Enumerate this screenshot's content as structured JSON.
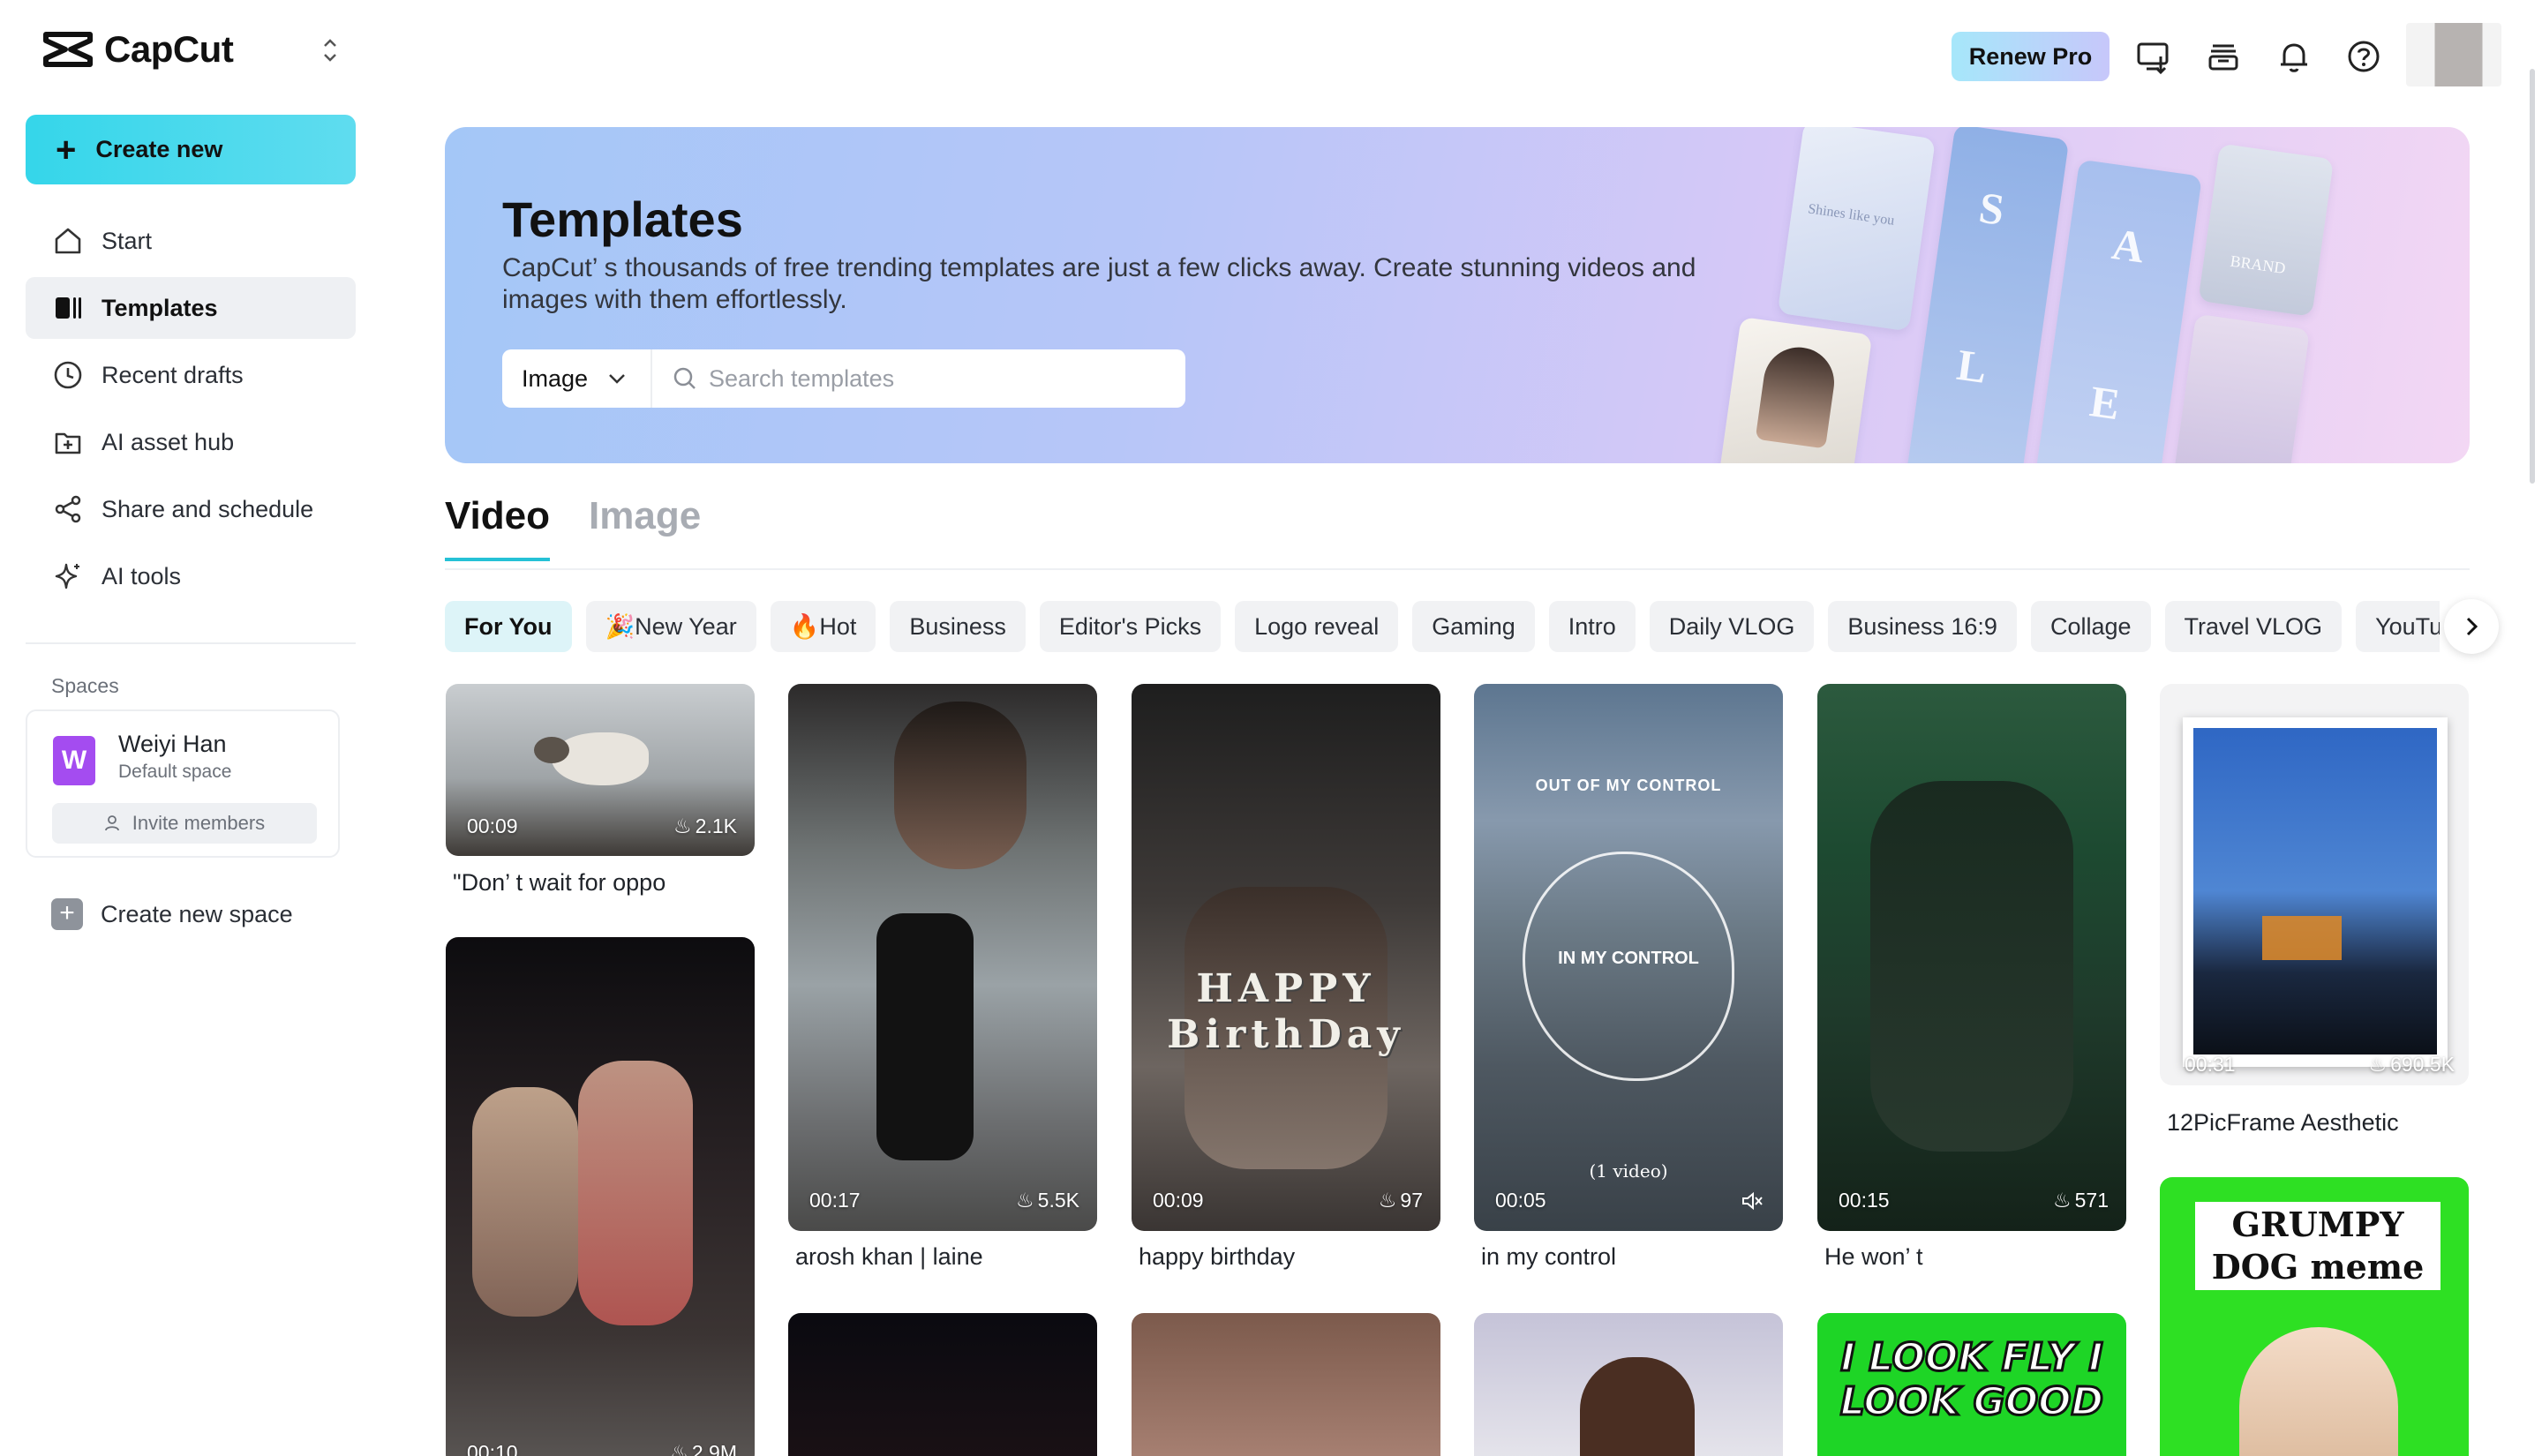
{
  "app": {
    "name": "CapCut"
  },
  "sidebar": {
    "create_label": "Create new",
    "items": [
      {
        "label": "Start",
        "icon": "home-icon"
      },
      {
        "label": "Templates",
        "icon": "templates-icon",
        "active": true
      },
      {
        "label": "Recent drafts",
        "icon": "clock-icon"
      },
      {
        "label": "AI asset hub",
        "icon": "asset-hub-icon"
      },
      {
        "label": "Share and schedule",
        "icon": "share-icon"
      },
      {
        "label": "AI tools",
        "icon": "sparkle-icon"
      }
    ],
    "spaces_title": "Spaces",
    "space": {
      "initial": "W",
      "name": "Weiyi Han",
      "subtitle": "Default space",
      "invite_label": "Invite members"
    },
    "create_space_label": "Create new space"
  },
  "topbar": {
    "renew_label": "Renew Pro",
    "icons": [
      "download-to-desktop-icon",
      "inbox-icon",
      "bell-icon",
      "help-icon"
    ]
  },
  "banner": {
    "title": "Templates",
    "description": "CapCut’ s thousands of free trending templates are just a few clicks away. Create stunning videos and images with them effortlessly.",
    "search_type": "Image",
    "search_placeholder": "Search templates",
    "collage_texts": [
      "Shines like you",
      "S",
      "A",
      "L",
      "E",
      "BRAND"
    ]
  },
  "tabs": [
    {
      "label": "Video",
      "active": true
    },
    {
      "label": "Image",
      "active": false
    }
  ],
  "chips": [
    {
      "label": "For You",
      "active": true
    },
    {
      "label": "🎉New Year"
    },
    {
      "label": "🔥Hot"
    },
    {
      "label": "Business"
    },
    {
      "label": "Editor's Picks"
    },
    {
      "label": "Logo reveal"
    },
    {
      "label": "Gaming"
    },
    {
      "label": "Intro"
    },
    {
      "label": "Daily VLOG"
    },
    {
      "label": "Business 16:9"
    },
    {
      "label": "Collage"
    },
    {
      "label": "Travel VLOG"
    },
    {
      "label": "YouTube Outro"
    }
  ],
  "templates": [
    {
      "title": "\"Don’ t wait for oppo",
      "duration": "00:09",
      "uses": "2.1K"
    },
    {
      "title": "",
      "duration": "00:10",
      "uses": "2.9M"
    },
    {
      "title": "arosh khan | laine",
      "duration": "00:17",
      "uses": "5.5K"
    },
    {
      "title": "",
      "duration": "",
      "uses": ""
    },
    {
      "title": "happy birthday",
      "duration": "00:09",
      "uses": "97",
      "overlay": "HAPPY BirthDay"
    },
    {
      "title": "",
      "duration": "",
      "uses": ""
    },
    {
      "title": "in my control",
      "duration": "00:05",
      "uses": "",
      "overlay_title": "OUT OF MY CONTROL",
      "overlay_center": "IN MY CONTROL",
      "overlay_bottom": "(1 video)"
    },
    {
      "title": "",
      "duration": "",
      "uses": ""
    },
    {
      "title": "He won’ t",
      "duration": "00:15",
      "uses": "571"
    },
    {
      "title": "",
      "duration": "",
      "uses": "",
      "overlay": "I LOOK FLY I LOOK GOOD"
    },
    {
      "title": "12PicFrame Aesthetic",
      "duration": "00:31",
      "uses": "690.5K"
    },
    {
      "title": "",
      "duration": "",
      "uses": "",
      "overlay": "GRUMPY DOG meme"
    }
  ]
}
